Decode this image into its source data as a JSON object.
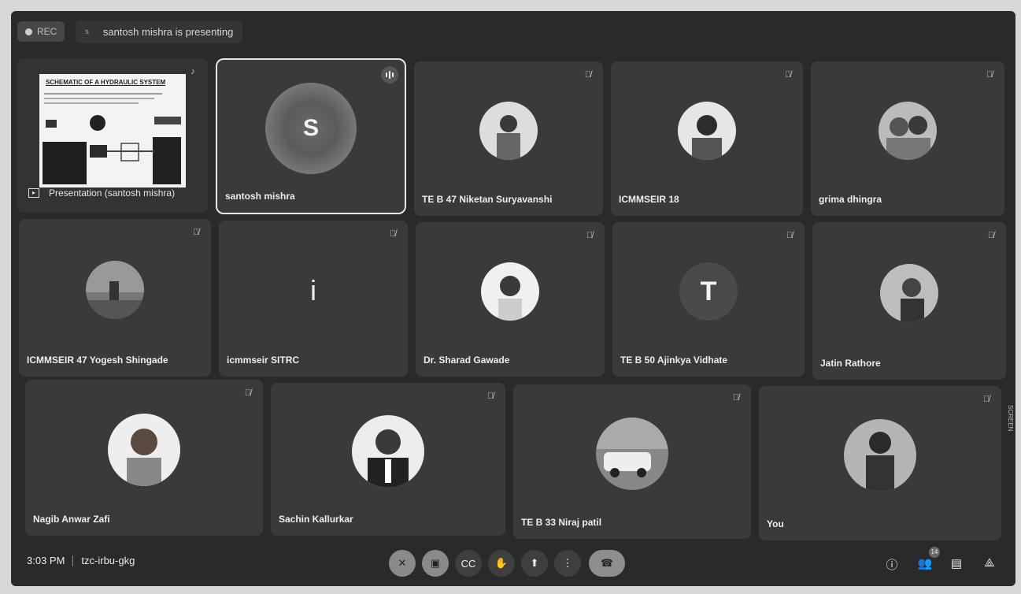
{
  "topbar": {
    "rec_label": "REC",
    "presenting_avatar": "s",
    "presenting_text": "santosh mishra is presenting"
  },
  "presentation": {
    "slide_title": "SCHEMATIC OF A HYDRAULIC SYSTEM",
    "label": "Presentation (santosh mishra)"
  },
  "participants": [
    {
      "name": "santosh mishra",
      "avatar": "S"
    },
    {
      "name": "TE B 47 Niketan Suryavanshi"
    },
    {
      "name": "ICMMSEIR 18"
    },
    {
      "name": "grima dhingra"
    },
    {
      "name": "ICMMSEIR 47 Yogesh Shingade"
    },
    {
      "name": "icmmseir SITRC",
      "avatar": "i"
    },
    {
      "name": "Dr. Sharad Gawade"
    },
    {
      "name": "TE B 50 Ajinkya Vidhate",
      "avatar": "T"
    },
    {
      "name": "Jatin Rathore"
    },
    {
      "name": "Nagib Anwar Zafi"
    },
    {
      "name": "Sachin Kallurkar"
    },
    {
      "name": "TE B 33 Niraj patil"
    },
    {
      "name": "You"
    }
  ],
  "bottombar": {
    "time": "3:03 PM",
    "meeting_code": "tzc-irbu-gkg",
    "people_count": "14"
  },
  "side_label": "SCREEN"
}
